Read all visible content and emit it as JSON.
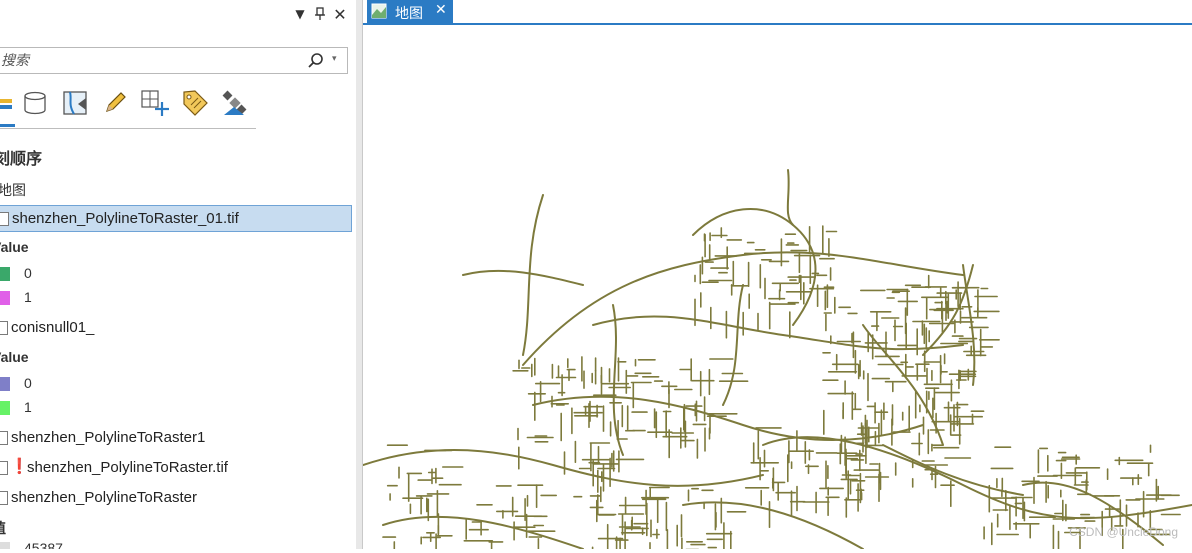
{
  "contents": {
    "search_placeholder": "搜索",
    "section_title": "刻顺序",
    "map_node": "地图",
    "layers": [
      {
        "name": "shenzhen_PolylineToRaster_01.tif",
        "selected": true,
        "legend_title": "Value",
        "legend": [
          {
            "label": "0",
            "color": "#3aa86a"
          },
          {
            "label": "1",
            "color": "#e060e8"
          }
        ]
      },
      {
        "name": "conisnull01_",
        "legend_title": "Value",
        "legend": [
          {
            "label": "0",
            "color": "#7f7fc8"
          },
          {
            "label": "1",
            "color": "#66f266"
          }
        ]
      },
      {
        "name": "shenzhen_PolylineToRaster1"
      },
      {
        "name": "shenzhen_PolylineToRaster.tif",
        "warning": "❗"
      },
      {
        "name": "shenzhen_PolylineToRaster",
        "legend_title": "值",
        "legend": [
          {
            "label": "45387"
          }
        ]
      }
    ]
  },
  "map": {
    "tab_label": "地图",
    "line_color": "#7d7a3c",
    "watermark": "CSDN @UncleDong"
  },
  "icons": {
    "pane": [
      "chevron-down-icon",
      "pin-icon",
      "close-icon"
    ],
    "toolbar": [
      "layers-icon",
      "database-icon",
      "map-frame-icon",
      "pencil-icon",
      "add-grid-icon",
      "label-tag-icon",
      "satellite-icon"
    ]
  }
}
